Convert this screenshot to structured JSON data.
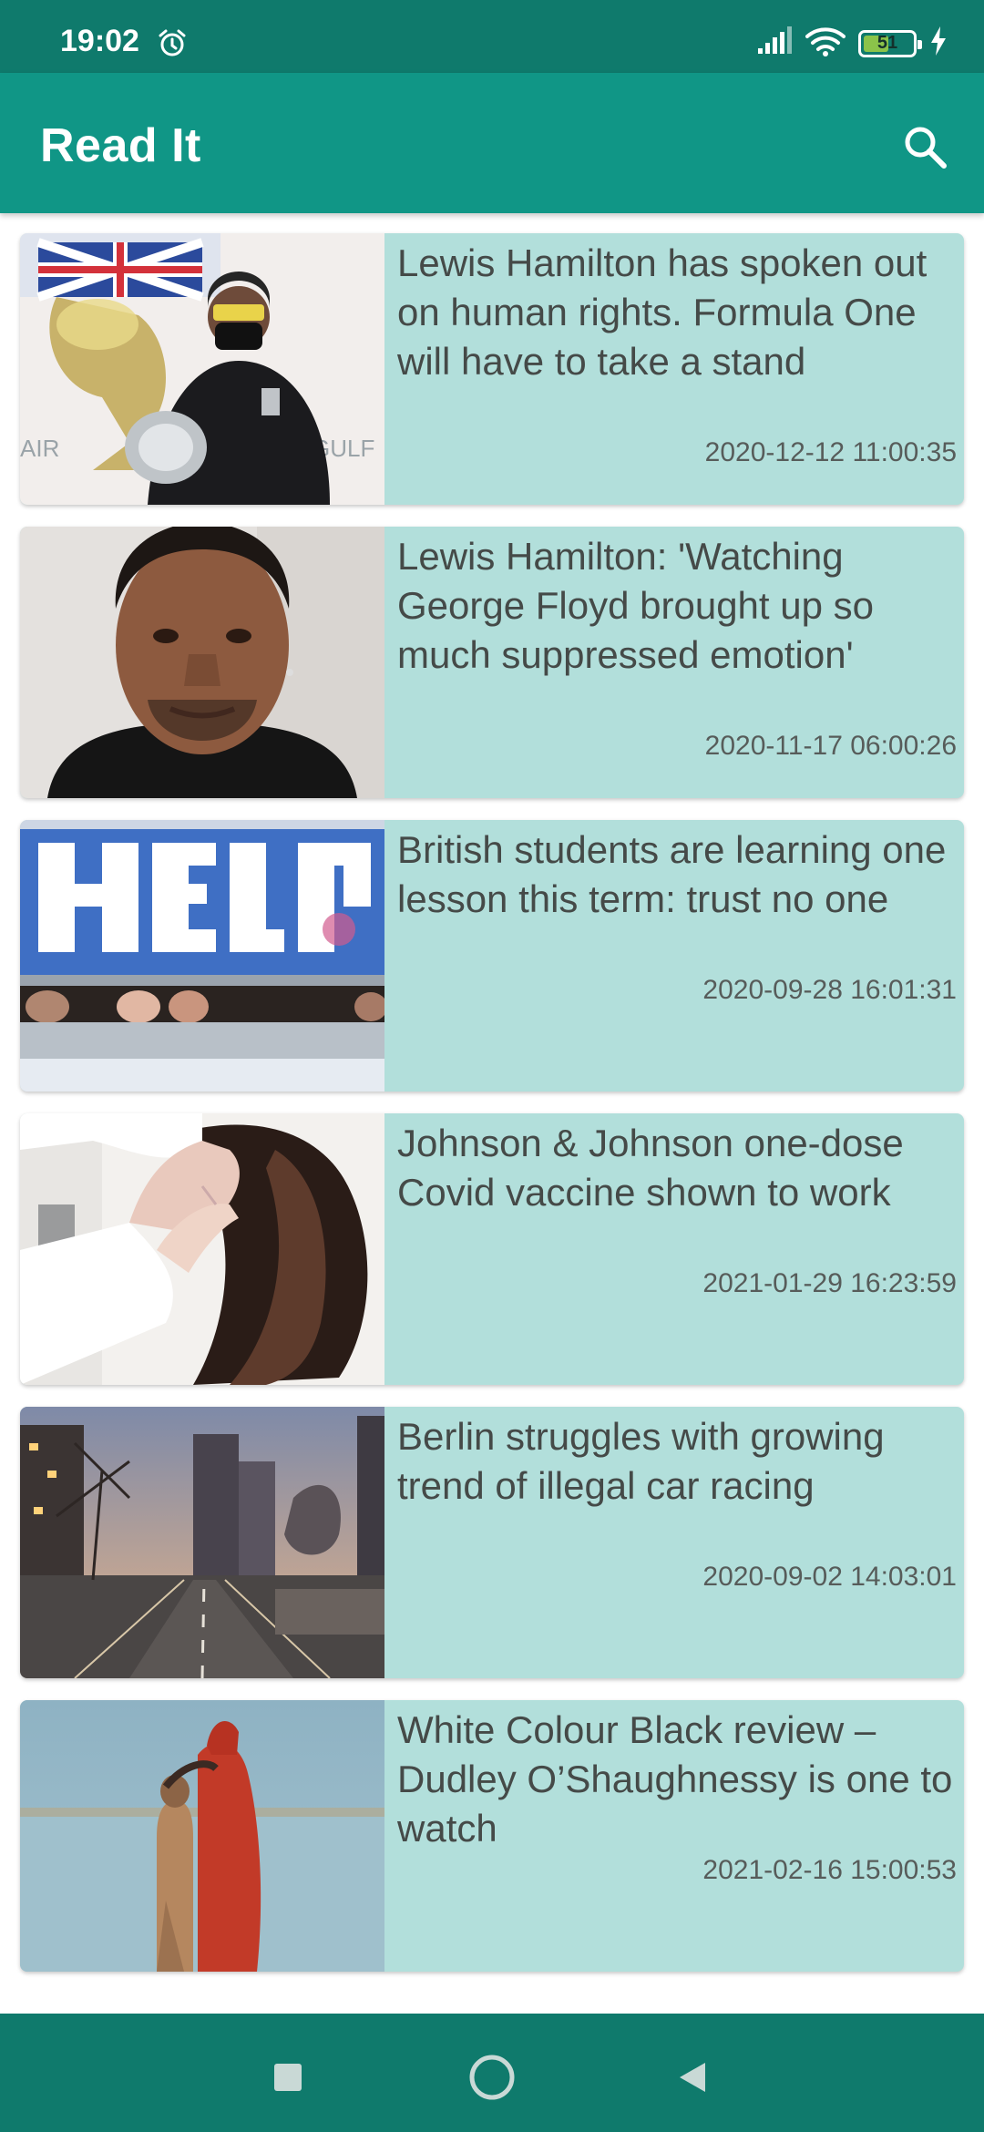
{
  "status_bar": {
    "time": "19:02",
    "battery": "51"
  },
  "app": {
    "title": "Read It"
  },
  "articles": [
    {
      "title": "Lewis Hamilton has spoken out on human rights. Formula One will have to take a stand",
      "date": "2020-12-12 11:00:35"
    },
    {
      "title": "Lewis Hamilton: 'Watching George Floyd brought up so much suppressed emotion'",
      "date": "2020-11-17 06:00:26"
    },
    {
      "title": "British students are learning one lesson this term: trust no one",
      "date": "2020-09-28 16:01:31"
    },
    {
      "title": "Johnson & Johnson one-dose Covid vaccine shown to work",
      "date": "2021-01-29 16:23:59"
    },
    {
      "title": "Berlin struggles with growing trend of illegal car racing",
      "date": "2020-09-02 14:03:01"
    },
    {
      "title": "White Colour Black review – Dudley O’Shaughnessy is one to watch",
      "date": "2021-02-16 15:00:53"
    }
  ],
  "colors": {
    "status_bar": "#0f7a6c",
    "app_bar": "#109686",
    "card_bg": "#b2dfdb",
    "nav_bar": "#0f7a6c"
  }
}
